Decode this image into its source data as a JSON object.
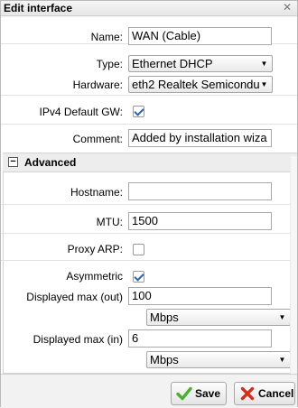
{
  "title": "Edit interface",
  "general": {
    "name_label": "Name:",
    "name_value": "WAN (Cable)",
    "type_label": "Type:",
    "type_value": "Ethernet DHCP",
    "hardware_label": "Hardware:",
    "hardware_value": "eth2 Realtek Semicondu",
    "ipv4_label": "IPv4 Default GW:",
    "ipv4_checked": true,
    "comment_label": "Comment:",
    "comment_value": "Added by installation wiza"
  },
  "advanced": {
    "title": "Advanced",
    "toggle_symbol": "−",
    "hostname_label": "Hostname:",
    "hostname_value": "",
    "mtu_label": "MTU:",
    "mtu_value": "1500",
    "proxy_arp_label": "Proxy ARP:",
    "proxy_arp_checked": false,
    "asymmetric_label": "Asymmetric",
    "asymmetric_checked": true,
    "max_out_label": "Displayed max (out)",
    "max_out_value": "100",
    "max_out_unit": "Mbps",
    "max_in_label": "Displayed max (in)",
    "max_in_value": "6",
    "max_in_unit": "Mbps"
  },
  "footer": {
    "save_label": "Save",
    "cancel_label": "Cancel"
  },
  "icons": {
    "close": "close-icon",
    "save": "check-icon",
    "cancel": "cross-icon",
    "dropdown": "triangle-down-icon"
  },
  "colors": {
    "checkmark": "#2f62b3",
    "save_icon": "#4caf2f",
    "cancel_icon": "#d32f1f"
  }
}
